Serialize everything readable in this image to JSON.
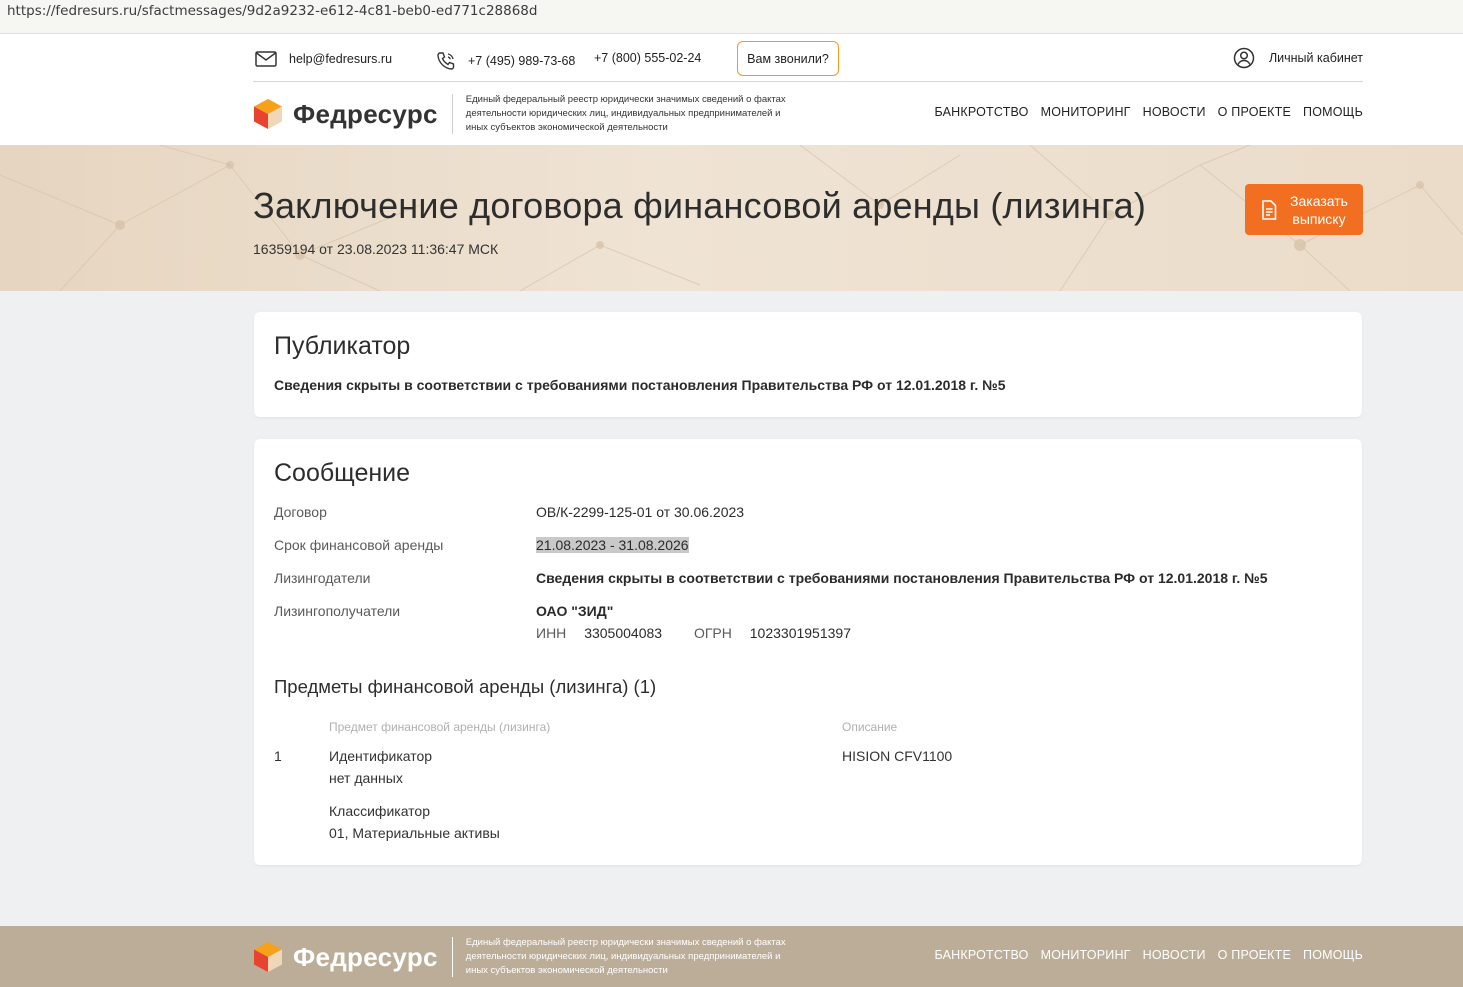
{
  "browser": {
    "url": "https://fedresurs.ru/sfactmessages/9d2a9232-e612-4c81-beb0-ed771c28868d"
  },
  "header": {
    "email": "help@fedresurs.ru",
    "phone1": "+7 (495) 989-73-68",
    "phone2": "+7 (800) 555-02-24",
    "call_button": "Вам звонили?",
    "cabinet": "Личный кабинет",
    "brand_name": "Федресурс",
    "brand_desc": "Единый федеральный реестр юридически значимых сведений о фактах деятельности юридических лиц, индивидуальных предпринимателей и иных субъектов экономической деятельности",
    "nav": [
      "БАНКРОТСТВО",
      "МОНИТОРИНГ",
      "НОВОСТИ",
      "О ПРОЕКТЕ",
      "ПОМОЩЬ"
    ]
  },
  "hero": {
    "title": "Заключение договора финансовой аренды (лизинга)",
    "subtitle": "16359194 от 23.08.2023 11:36:47 МСК",
    "order_button": "Заказать выписку"
  },
  "publisher": {
    "title": "Публикатор",
    "text": "Сведения скрыты в соответствии с требованиями постановления Правительства РФ от 12.01.2018 г. №5"
  },
  "message": {
    "title": "Сообщение",
    "rows": [
      {
        "label": "Договор",
        "value": "ОВ/К-2299-125-01 от 30.06.2023"
      },
      {
        "label": "Срок финансовой аренды",
        "value": "21.08.2023 - 31.08.2026"
      },
      {
        "label": "Лизингодатели",
        "value": "Сведения скрыты в соответствии с требованиями постановления Правительства РФ от 12.01.2018 г. №5"
      },
      {
        "label": "Лизингополучатели",
        "value": "ОАО \"ЗИД\""
      }
    ],
    "inn_label": "ИНН",
    "inn": "3305004083",
    "ogrn_label": "ОГРН",
    "ogrn": "1023301951397",
    "subjects_title": "Предметы финансовой аренды (лизинга) (1)",
    "col_subject": "Предмет финансовой аренды (лизинга)",
    "col_desc": "Описание",
    "item": {
      "num": "1",
      "id_label": "Идентификатор",
      "id_value": "нет данных",
      "class_label": "Классификатор",
      "class_value": "01, Материальные активы",
      "description": "HISION CFV1100"
    }
  },
  "footer": {
    "brand_name": "Федресурс",
    "brand_desc": "Единый федеральный реестр юридически значимых сведений о фактах деятельности юридических лиц, индивидуальных предпринимателей и иных субъектов экономической деятельности",
    "nav": [
      "БАНКРОТСТВО",
      "МОНИТОРИНГ",
      "НОВОСТИ",
      "О ПРОЕКТЕ",
      "ПОМОЩЬ"
    ]
  },
  "colors": {
    "accent": "#f26f21",
    "call_border": "#f39a1e",
    "hero_bg": "#e9dac7",
    "footer_bg": "#bcad98"
  },
  "icons": [
    "mail-icon",
    "phone-icon",
    "user-circle-icon",
    "logo-cube-icon",
    "document-icon"
  ]
}
